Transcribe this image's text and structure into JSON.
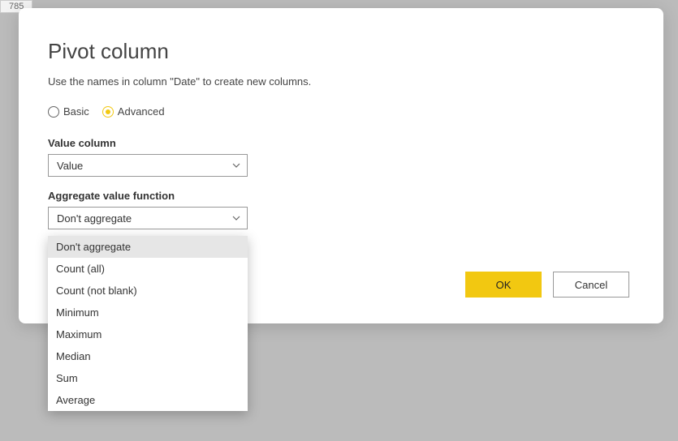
{
  "bg_cell": "785",
  "dialog": {
    "title": "Pivot column",
    "subtitle": "Use the names in column \"Date\" to create new columns.",
    "mode": {
      "basic_label": "Basic",
      "advanced_label": "Advanced",
      "selected": "advanced"
    },
    "value_column": {
      "label": "Value column",
      "selected": "Value"
    },
    "aggregate": {
      "label": "Aggregate value function",
      "selected": "Don't aggregate",
      "options": [
        "Don't aggregate",
        "Count (all)",
        "Count (not blank)",
        "Minimum",
        "Maximum",
        "Median",
        "Sum",
        "Average"
      ]
    },
    "buttons": {
      "ok": "OK",
      "cancel": "Cancel"
    }
  }
}
